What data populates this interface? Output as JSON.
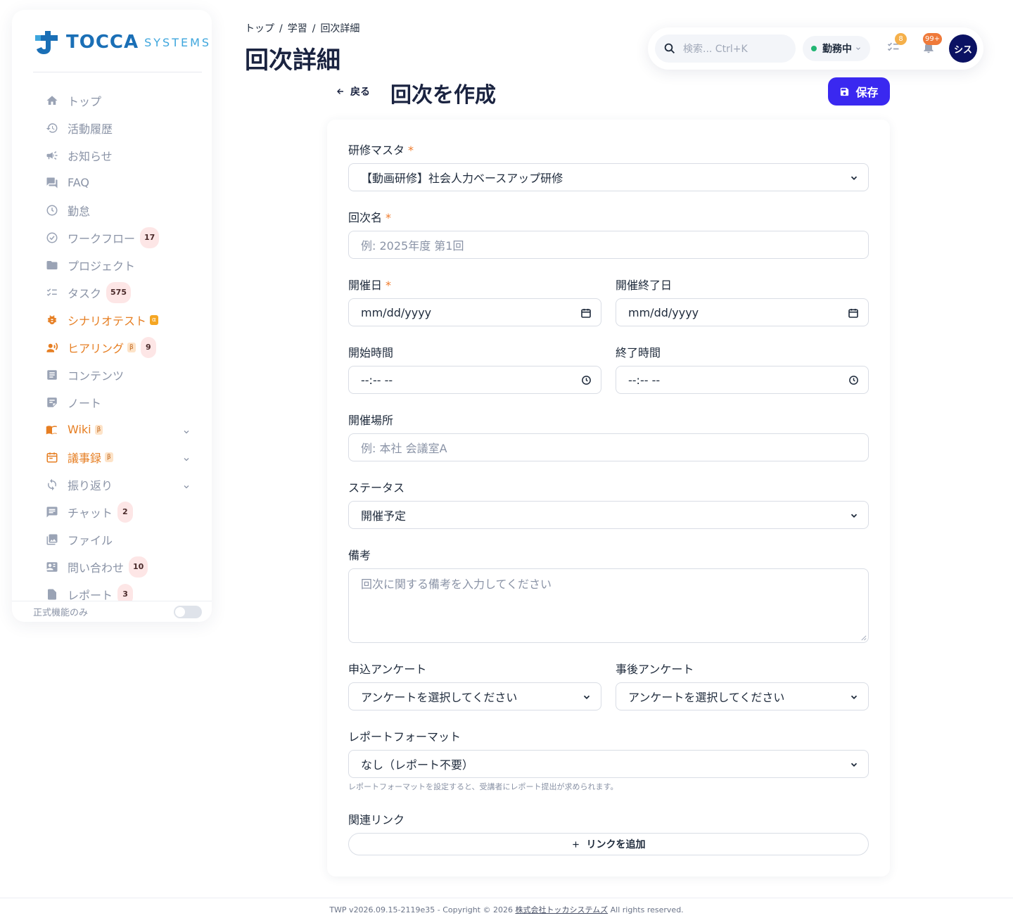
{
  "logo": {
    "word": "TOCCA",
    "sub": "SYSTEMS"
  },
  "sidebar": {
    "items": [
      {
        "label": "トップ",
        "icon": "home-icon"
      },
      {
        "label": "活動履歴",
        "icon": "history-icon"
      },
      {
        "label": "お知らせ",
        "icon": "megaphone-icon"
      },
      {
        "label": "FAQ",
        "icon": "chat-bubbles-icon"
      },
      {
        "label": "勤怠",
        "icon": "clock-icon"
      },
      {
        "label": "ワークフロー",
        "icon": "check-circle-icon",
        "badge": "17"
      },
      {
        "label": "プロジェクト",
        "icon": "folder-icon"
      },
      {
        "label": "タスク",
        "icon": "checklist-icon",
        "badge": "575"
      },
      {
        "label": "シナリオテスト",
        "icon": "bug-icon",
        "tag": "α"
      },
      {
        "label": "ヒアリング",
        "icon": "people-voice-icon",
        "tag": "β",
        "badge": "9"
      },
      {
        "label": "コンテンツ",
        "icon": "article-icon"
      },
      {
        "label": "ノート",
        "icon": "note-icon"
      },
      {
        "label": "Wiki",
        "icon": "book-icon",
        "tag": "β"
      },
      {
        "label": "議事録",
        "icon": "calendar-icon",
        "tag": "β"
      },
      {
        "label": "振り返り",
        "icon": "refresh-icon"
      },
      {
        "label": "チャット",
        "icon": "chat-icon",
        "badge": "2"
      },
      {
        "label": "ファイル",
        "icon": "image-icon"
      },
      {
        "label": "問い合わせ",
        "icon": "contact-card-icon",
        "badge": "10"
      },
      {
        "label": "レポート",
        "icon": "report-icon",
        "badge": "3"
      }
    ],
    "footer_label": "正式機能のみ"
  },
  "breadcrumb": [
    "トップ",
    "学習",
    "回次詳細"
  ],
  "page_title": "回次詳細",
  "topbar": {
    "search_placeholder": "検索... Ctrl+K",
    "work_status": "勤務中",
    "task_count": "8",
    "notif_count": "99+",
    "avatar": "シス"
  },
  "form": {
    "back_label": "戻る",
    "title": "回次を作成",
    "save_label": "保存",
    "master_label": "研修マスタ",
    "master_value": "【動画研修】社会人力ベースアップ研修",
    "name_label": "回次名",
    "name_placeholder": "例: 2025年度 第1回",
    "date_label": "開催日",
    "date_value": "mm/dd/yyyy",
    "end_date_label": "開催終了日",
    "end_date_value": "mm/dd/yyyy",
    "start_time_label": "開始時間",
    "start_time_value": "--:-- --",
    "end_time_label": "終了時間",
    "end_time_value": "--:-- --",
    "place_label": "開催場所",
    "place_placeholder": "例: 本社 会議室A",
    "status_label": "ステータス",
    "status_value": "開催予定",
    "notes_label": "備考",
    "notes_placeholder": "回次に関する備考を入力してください",
    "apply_survey_label": "申込アンケート",
    "apply_survey_value": "アンケートを選択してください",
    "post_survey_label": "事後アンケート",
    "post_survey_value": "アンケートを選択してください",
    "report_label": "レポートフォーマット",
    "report_value": "なし（レポート不要）",
    "report_hint": "レポートフォーマットを設定すると、受講者にレポート提出が求められます。",
    "links_label": "関連リンク",
    "add_link_label": "リンクを追加"
  },
  "footer": {
    "prefix": "TWP v2026.09.15-2119e35 - Copyright © 2026 ",
    "company": "株式会社トッカシステムズ",
    "suffix": " All rights reserved."
  },
  "colors": {
    "accent": "#3a28f0",
    "orange": "#e67e22",
    "navy": "#0b1263"
  }
}
